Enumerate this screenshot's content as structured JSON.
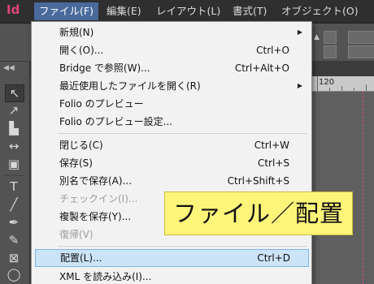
{
  "app": {
    "logo": "Id"
  },
  "menubar": {
    "items": [
      {
        "id": "file",
        "label": "ファイル(F)",
        "active": true
      },
      {
        "id": "edit",
        "label": "編集(E)"
      },
      {
        "id": "layout",
        "label": "レイアウト(L)"
      },
      {
        "id": "type",
        "label": "書式(T)"
      },
      {
        "id": "object",
        "label": "オブジェクト(O)"
      }
    ]
  },
  "ruler": {
    "mark": "120"
  },
  "file_menu": {
    "items": [
      {
        "label": "新規(N)",
        "shortcut": "",
        "submenu": true
      },
      {
        "label": "開く(O)...",
        "shortcut": "Ctrl+O"
      },
      {
        "label": "Bridge で参照(W)...",
        "shortcut": "Ctrl+Alt+O"
      },
      {
        "label": "最近使用したファイルを開く(R)",
        "shortcut": "",
        "submenu": true
      },
      {
        "label": "Folio のプレビュー",
        "shortcut": ""
      },
      {
        "label": "Folio のプレビュー設定...",
        "shortcut": ""
      },
      {
        "label": "閉じる(C)",
        "shortcut": "Ctrl+W"
      },
      {
        "label": "保存(S)",
        "shortcut": "Ctrl+S"
      },
      {
        "label": "別名で保存(A)...",
        "shortcut": "Ctrl+Shift+S"
      },
      {
        "label": "チェックイン(I)...",
        "shortcut": "",
        "disabled": true
      },
      {
        "label": "複製を保存(Y)...",
        "shortcut": ""
      },
      {
        "label": "復帰(V)",
        "shortcut": "",
        "disabled": true
      },
      {
        "label": "配置(L)...",
        "shortcut": "Ctrl+D",
        "highlighted": true
      },
      {
        "label": "XML を読み込み(I)...",
        "shortcut": ""
      }
    ]
  },
  "caption": {
    "text": "ファイル／配置"
  }
}
